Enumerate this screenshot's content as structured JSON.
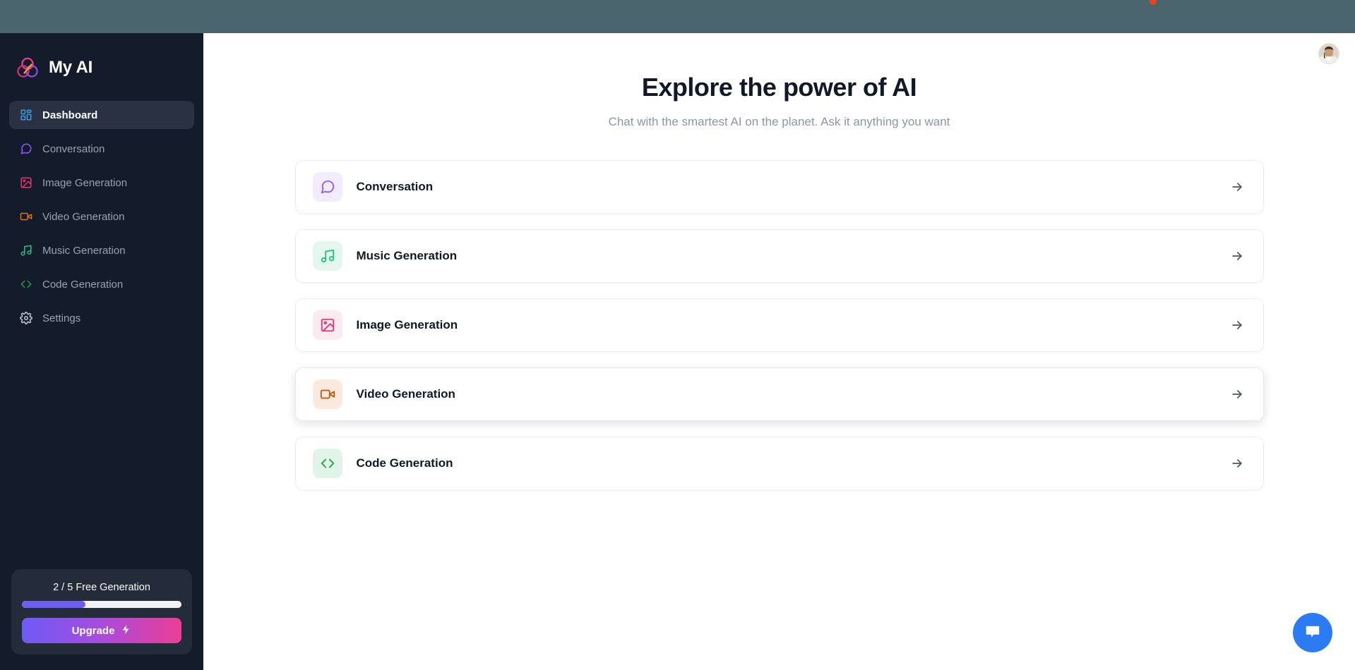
{
  "brand": {
    "title": "My AI",
    "logo_icon": "venn-circles-logo"
  },
  "colors": {
    "sidebar_bg": "#141b2b",
    "topbar_bg": "#4a656d",
    "active_nav_bg": "#2a3142",
    "progress_fill": "#6d5ef0",
    "upgrade_gradient_start": "#6d5bf5",
    "upgrade_gradient_end": "#ec3d96",
    "chat_fab": "#2b7bf3",
    "title_text": "#111827",
    "subtitle_text": "#8b96a8"
  },
  "sidebar": {
    "items": [
      {
        "label": "Dashboard",
        "icon": "layout-grid-icon",
        "color": "#3b9ae1",
        "active": true
      },
      {
        "label": "Conversation",
        "icon": "message-square-icon",
        "color": "#8b5cf6",
        "active": false
      },
      {
        "label": "Image Generation",
        "icon": "image-icon",
        "color": "#e8356d",
        "active": false
      },
      {
        "label": "Video Generation",
        "icon": "video-camera-icon",
        "color": "#e2700e",
        "active": false
      },
      {
        "label": "Music Generation",
        "icon": "music-note-icon",
        "color": "#22c08a",
        "active": false
      },
      {
        "label": "Code Generation",
        "icon": "code-brackets-icon",
        "color": "#1f9e52",
        "active": false
      },
      {
        "label": "Settings",
        "icon": "gear-icon",
        "color": "#c4cad4",
        "active": false
      }
    ],
    "upgrade": {
      "count_label": "2 / 5 Free Generation",
      "progress_percent": 40,
      "button_label": "Upgrade",
      "button_icon": "lightning-bolt-icon"
    }
  },
  "main": {
    "title": "Explore the power of AI",
    "subtitle": "Chat with the smartest AI on the planet. Ask it anything you want",
    "avatar_icon": "user-avatar",
    "cards": [
      {
        "label": "Conversation",
        "icon": "message-square-icon",
        "color": "#8b5cf6",
        "tile_bg": "#f2ecfe",
        "arrow": "arrow-right-icon",
        "hover": false
      },
      {
        "label": "Music Generation",
        "icon": "music-note-icon",
        "color": "#22c08a",
        "tile_bg": "#e3f7ee",
        "arrow": "arrow-right-icon",
        "hover": false
      },
      {
        "label": "Image Generation",
        "icon": "image-icon",
        "color": "#e8356d",
        "tile_bg": "#fceaf1",
        "arrow": "arrow-right-icon",
        "hover": false
      },
      {
        "label": "Video Generation",
        "icon": "video-camera-icon",
        "color": "#c0570c",
        "tile_bg": "#fbe9dd",
        "arrow": "arrow-right-icon",
        "hover": true
      },
      {
        "label": "Code Generation",
        "icon": "code-brackets-icon",
        "color": "#1f9e52",
        "tile_bg": "#e1f4e8",
        "arrow": "arrow-right-icon",
        "hover": false
      }
    ],
    "chat_fab_icon": "chat-bubble-icon"
  }
}
